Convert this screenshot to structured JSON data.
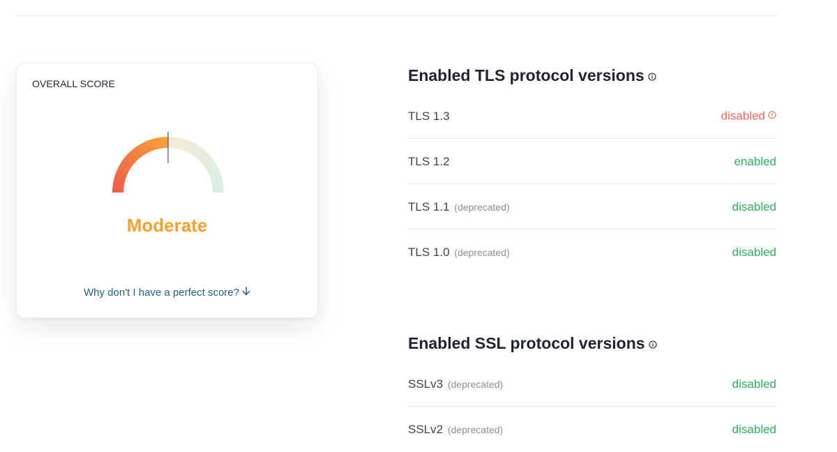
{
  "score_card": {
    "label": "OVERALL SCORE",
    "score": "Moderate",
    "score_level": 0.5,
    "link": "Why don't I have a perfect score?",
    "link_icon": "arrow-down-icon",
    "colors": {
      "gauge_start": "#ef5a4c",
      "gauge_mid": "#f7a43a",
      "gauge_rest_start": "#f8ead6",
      "gauge_rest_end": "#d6efe3",
      "score": "#f6a12a",
      "link": "#1f5f8b"
    }
  },
  "tls": {
    "title": "Enabled TLS protocol versions",
    "info_icon": "info-icon",
    "rows": [
      {
        "name": "TLS 1.3",
        "note": "",
        "status": "disabled",
        "status_kind": "bad",
        "status_icon": "info-icon"
      },
      {
        "name": "TLS 1.2",
        "note": "",
        "status": "enabled",
        "status_kind": "ok"
      },
      {
        "name": "TLS 1.1",
        "note": "(deprecated)",
        "status": "disabled",
        "status_kind": "ok"
      },
      {
        "name": "TLS 1.0",
        "note": "(deprecated)",
        "status": "disabled",
        "status_kind": "ok"
      }
    ]
  },
  "ssl": {
    "title": "Enabled SSL protocol versions",
    "info_icon": "info-icon",
    "rows": [
      {
        "name": "SSLv3",
        "note": "(deprecated)",
        "status": "disabled",
        "status_kind": "ok"
      },
      {
        "name": "SSLv2",
        "note": "(deprecated)",
        "status": "disabled",
        "status_kind": "ok"
      }
    ]
  },
  "colors": {
    "ok": "#2fae5e",
    "bad": "#ef6b5c",
    "text": "#1f2430",
    "muted": "#8c8f97"
  }
}
